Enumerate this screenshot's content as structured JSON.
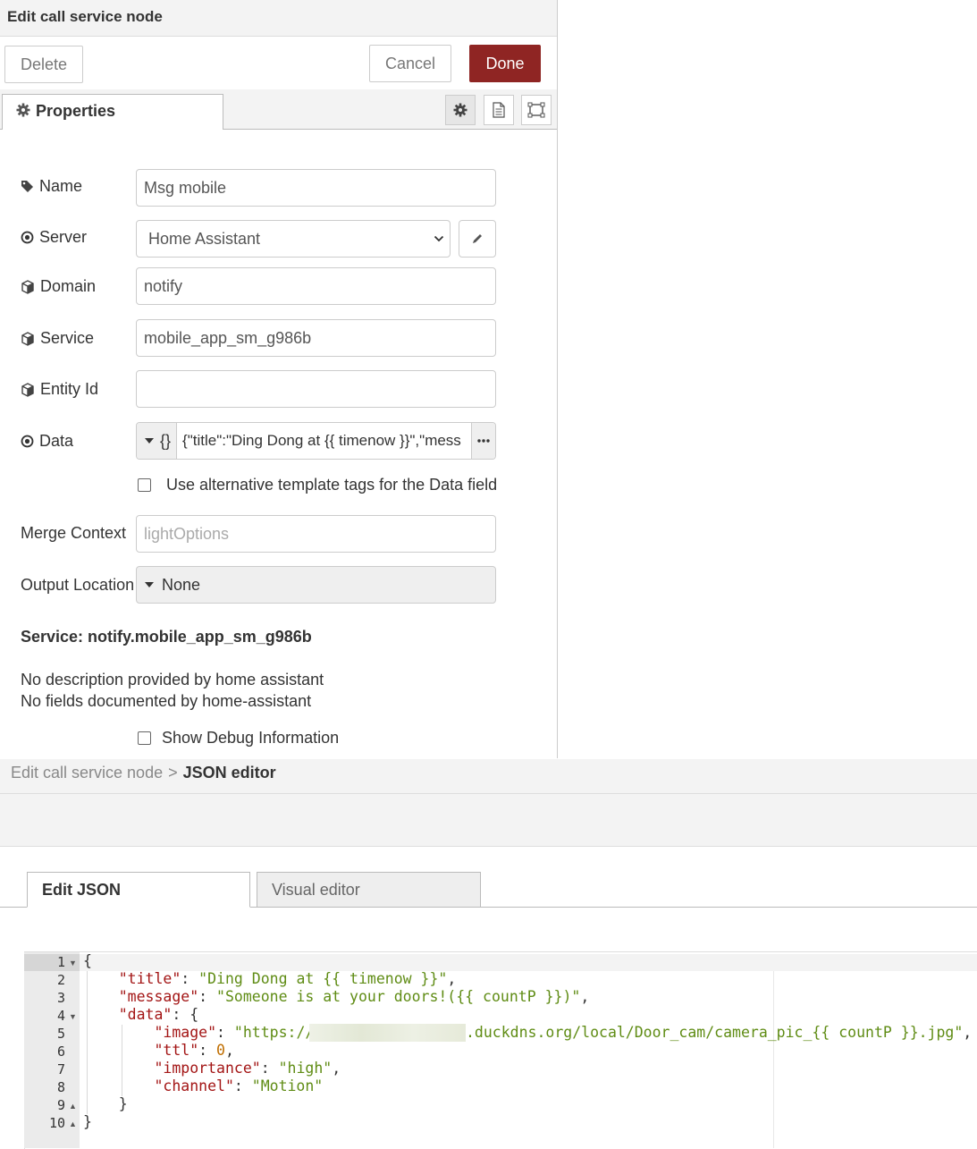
{
  "dialog": {
    "title": "Edit call service node",
    "delete_label": "Delete",
    "cancel_label": "Cancel",
    "done_label": "Done",
    "tab_properties": "Properties"
  },
  "form": {
    "name_label": "Name",
    "name_value": "Msg mobile",
    "server_label": "Server",
    "server_value": "Home Assistant",
    "domain_label": "Domain",
    "domain_value": "notify",
    "service_label": "Service",
    "service_value": "mobile_app_sm_g986b",
    "entity_label": "Entity Id",
    "entity_value": "",
    "data_label": "Data",
    "data_type": "{}",
    "data_value": "{\"title\":\"Ding Dong at {{ timenow }}\",\"mess",
    "alt_tags_label": "Use alternative template tags for the Data field",
    "merge_label": "Merge Context",
    "merge_placeholder": "lightOptions",
    "output_label": "Output Location",
    "output_value": "None",
    "service_info": "Service: notify.mobile_app_sm_g986b",
    "no_desc": "No description provided by home assistant",
    "no_fields": "No fields documented by home-assistant",
    "debug_label": "Show Debug Information"
  },
  "json_editor": {
    "crumb_parent": "Edit call service node",
    "crumb_sep": ">",
    "crumb_current": "JSON editor",
    "tab_edit": "Edit JSON",
    "tab_visual": "Visual editor",
    "line_numbers": [
      "1",
      "2",
      "3",
      "4",
      "5",
      "6",
      "7",
      "8",
      "9",
      "10"
    ],
    "code": {
      "l1": "{",
      "title_key": "\"title\"",
      "title_val": "\"Ding Dong at {{ timenow }}\"",
      "message_key": "\"message\"",
      "message_val": "\"Someone is at your doors!({{ countP }})\"",
      "data_key": "\"data\"",
      "image_key": "\"image\"",
      "image_val_start": "\"https://",
      "image_val_end": ".duckdns.org/local/Door_cam/camera_pic_{{ countP }}.jpg\"",
      "ttl_key": "\"ttl\"",
      "ttl_val": "0",
      "importance_key": "\"importance\"",
      "importance_val": "\"high\"",
      "channel_key": "\"channel\"",
      "channel_val": "\"Motion\"",
      "close_inner": "}",
      "close_outer": "}"
    }
  }
}
